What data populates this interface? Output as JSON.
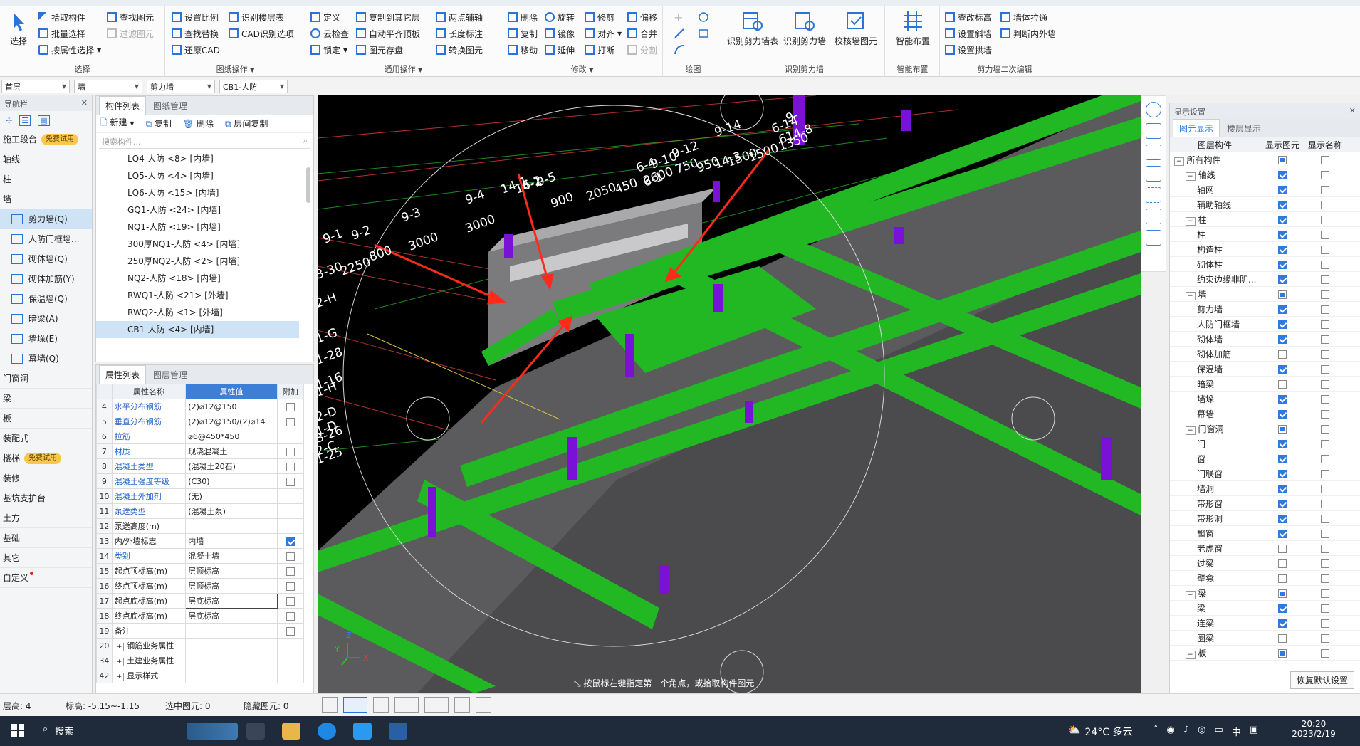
{
  "ribbon": {
    "tabs": [],
    "select": {
      "title": "选择",
      "big": "选择",
      "items": [
        "拾取构件",
        "批量选择",
        "按属性选择",
        "查找图元",
        "过滤图元"
      ]
    },
    "drawing_ops": {
      "title": "图纸操作",
      "items": [
        "设置比例",
        "查找替换",
        "还原CAD",
        "识别楼层表",
        "CAD识别选项"
      ]
    },
    "general_ops": {
      "title": "通用操作",
      "items": [
        "定义",
        "云检查",
        "锁定",
        "复制到其它层",
        "自动平齐顶板",
        "图元存盘",
        "两点辅轴",
        "长度标注",
        "转换图元"
      ]
    },
    "modify": {
      "title": "修改",
      "items": [
        "删除",
        "复制",
        "移动",
        "旋转",
        "镜像",
        "延伸",
        "修剪",
        "对齐",
        "打断",
        "偏移",
        "合并",
        "分割"
      ]
    },
    "draw": {
      "title": "绘图"
    },
    "recognize": {
      "title": "识别剪力墙",
      "items": [
        "识别剪力墙表",
        "识别剪力墙",
        "校核墙图元"
      ]
    },
    "smart": {
      "title": "智能布置",
      "items": [
        "智能布置"
      ]
    },
    "secondary": {
      "title": "剪力墙二次编辑",
      "items": [
        "查改标高",
        "设置斜墙",
        "设置拱墙",
        "墙体拉通",
        "判断内外墙"
      ]
    }
  },
  "floorbar": {
    "floor": "首层",
    "type": "墙",
    "subtype": "剪力墙",
    "component": "CB1-人防"
  },
  "nav": {
    "title": "导航栏",
    "trial_label": "免费试用",
    "categories_top": [
      "施工段台",
      "轴线",
      "柱",
      "墙"
    ],
    "wall_items": [
      "剪力墙(Q)",
      "人防门框墙...",
      "砌体墙(Q)",
      "砌体加筋(Y)",
      "保温墙(Q)",
      "暗梁(A)",
      "墙垛(E)",
      "幕墙(Q)"
    ],
    "categories_bottom": [
      "门窗洞",
      "梁",
      "板",
      "装配式",
      "楼梯",
      "装修",
      "基坑支护台",
      "土方",
      "基础",
      "其它",
      "自定义"
    ]
  },
  "comp_panel": {
    "tabs": [
      "构件列表",
      "图纸管理"
    ],
    "tools": [
      "新建",
      "复制",
      "删除",
      "层间复制"
    ],
    "search_placeholder": "搜索构件...",
    "items": [
      "LQ4-人防 <8> [内墙]",
      "LQ5-人防 <4> [内墙]",
      "LQ6-人防 <15> [内墙]",
      "GQ1-人防 <24> [内墙]",
      "NQ1-人防 <19> [内墙]",
      "300厚NQ1-人防 <4> [内墙]",
      "250厚NQ2-人防 <2> [内墙]",
      "NQ2-人防 <18> [内墙]",
      "RWQ1-人防 <21> [外墙]",
      "RWQ2-人防 <1> [外墙]",
      "CB1-人防 <4> [内墙]"
    ],
    "selected_index": 10
  },
  "prop_panel": {
    "tabs": [
      "属性列表",
      "图层管理"
    ],
    "headers": [
      "属性名称",
      "属性值",
      "附加"
    ],
    "rows": [
      {
        "n": "4",
        "name": "水平分布钢筋",
        "value": "(2)⌀12@150",
        "link": true,
        "add": "off"
      },
      {
        "n": "5",
        "name": "垂直分布钢筋",
        "value": "(2)⌀12@150/(2)⌀14",
        "link": true,
        "add": "off"
      },
      {
        "n": "6",
        "name": "拉筋",
        "value": "⌀6@450*450",
        "link": true,
        "add": ""
      },
      {
        "n": "7",
        "name": "材质",
        "value": "现浇混凝土",
        "link": true,
        "add": "off"
      },
      {
        "n": "8",
        "name": "混凝土类型",
        "value": "(混凝土20石)",
        "link": true,
        "add": "off"
      },
      {
        "n": "9",
        "name": "混凝土强度等级",
        "value": "(C30)",
        "link": true,
        "add": "off"
      },
      {
        "n": "10",
        "name": "混凝土外加剂",
        "value": "(无)",
        "link": true,
        "add": ""
      },
      {
        "n": "11",
        "name": "泵送类型",
        "value": "(混凝土泵)",
        "link": true,
        "add": ""
      },
      {
        "n": "12",
        "name": "泵送高度(m)",
        "value": "",
        "link": false,
        "add": ""
      },
      {
        "n": "13",
        "name": "内/外墙标志",
        "value": "内墙",
        "link": false,
        "add": "on"
      },
      {
        "n": "14",
        "name": "类别",
        "value": "混凝土墙",
        "link": true,
        "add": "off"
      },
      {
        "n": "15",
        "name": "起点顶标高(m)",
        "value": "层顶标高",
        "link": false,
        "add": "off"
      },
      {
        "n": "16",
        "name": "终点顶标高(m)",
        "value": "层顶标高",
        "link": false,
        "add": "off"
      },
      {
        "n": "17",
        "name": "起点底标高(m)",
        "value": "层底标高",
        "link": false,
        "add": "off"
      },
      {
        "n": "18",
        "name": "终点底标高(m)",
        "value": "层底标高",
        "link": false,
        "add": "off"
      },
      {
        "n": "19",
        "name": "备注",
        "value": "",
        "link": false,
        "add": "off"
      },
      {
        "n": "20",
        "name": "钢筋业务属性",
        "value": "",
        "link": false,
        "add": "",
        "expand": true
      },
      {
        "n": "34",
        "name": "土建业务属性",
        "value": "",
        "link": false,
        "add": "",
        "expand": true
      },
      {
        "n": "42",
        "name": "显示样式",
        "value": "",
        "link": false,
        "add": "",
        "expand": true
      }
    ]
  },
  "viewport": {
    "labels": [
      "9-14",
      "6-14",
      "6-1",
      "9-10",
      "9-12",
      "6-4",
      "614-8",
      "9-",
      "14-3",
      "1350",
      "750",
      "950",
      "1500",
      "1500",
      "2600",
      "2050",
      "450",
      "900",
      "3000",
      "3000",
      "800",
      "2250",
      "9-3",
      "9-4",
      "14-1",
      "14-1",
      "6-2",
      "9-5",
      "9-1",
      "9-2",
      "3-30",
      "2-H",
      "1-G",
      "1-28",
      "2-D",
      "1-D",
      "3-26",
      "2-C",
      "1-25",
      "1-16",
      "1-H"
    ],
    "status_hint": "按鼠标左键指定第一个角点，或拾取构件图元"
  },
  "display_panel": {
    "title": "显示设置",
    "tabs": [
      "图元显示",
      "楼层显示"
    ],
    "headers": [
      "图层构件",
      "显示图元",
      "显示名称"
    ],
    "rows": [
      {
        "name": "所有构件",
        "lvl": 0,
        "exp": true,
        "a": "part",
        "b": "off"
      },
      {
        "name": "轴线",
        "lvl": 1,
        "exp": true,
        "a": "on",
        "b": "off"
      },
      {
        "name": "轴网",
        "lvl": 2,
        "a": "on",
        "b": "off"
      },
      {
        "name": "辅助轴线",
        "lvl": 2,
        "a": "on",
        "b": "off"
      },
      {
        "name": "柱",
        "lvl": 1,
        "exp": true,
        "a": "on",
        "b": "off"
      },
      {
        "name": "柱",
        "lvl": 2,
        "a": "on",
        "b": "off"
      },
      {
        "name": "构造柱",
        "lvl": 2,
        "a": "on",
        "b": "off"
      },
      {
        "name": "砌体柱",
        "lvl": 2,
        "a": "on",
        "b": "off"
      },
      {
        "name": "约束边缘非阴...",
        "lvl": 2,
        "a": "on",
        "b": "off"
      },
      {
        "name": "墙",
        "lvl": 1,
        "exp": true,
        "a": "part",
        "b": "off"
      },
      {
        "name": "剪力墙",
        "lvl": 2,
        "a": "on",
        "b": "off"
      },
      {
        "name": "人防门框墙",
        "lvl": 2,
        "a": "on",
        "b": "off"
      },
      {
        "name": "砌体墙",
        "lvl": 2,
        "a": "on",
        "b": "off"
      },
      {
        "name": "砌体加筋",
        "lvl": 2,
        "a": "off",
        "b": "off"
      },
      {
        "name": "保温墙",
        "lvl": 2,
        "a": "on",
        "b": "off"
      },
      {
        "name": "暗梁",
        "lvl": 2,
        "a": "off",
        "b": "off"
      },
      {
        "name": "墙垛",
        "lvl": 2,
        "a": "on",
        "b": "off"
      },
      {
        "name": "幕墙",
        "lvl": 2,
        "a": "on",
        "b": "off"
      },
      {
        "name": "门窗洞",
        "lvl": 1,
        "exp": true,
        "a": "part",
        "b": "off"
      },
      {
        "name": "门",
        "lvl": 2,
        "a": "on",
        "b": "off"
      },
      {
        "name": "窗",
        "lvl": 2,
        "a": "on",
        "b": "off"
      },
      {
        "name": "门联窗",
        "lvl": 2,
        "a": "on",
        "b": "off"
      },
      {
        "name": "墙洞",
        "lvl": 2,
        "a": "on",
        "b": "off"
      },
      {
        "name": "带形窗",
        "lvl": 2,
        "a": "on",
        "b": "off"
      },
      {
        "name": "带形洞",
        "lvl": 2,
        "a": "on",
        "b": "off"
      },
      {
        "name": "飘窗",
        "lvl": 2,
        "a": "on",
        "b": "off"
      },
      {
        "name": "老虎窗",
        "lvl": 2,
        "a": "off",
        "b": "off"
      },
      {
        "name": "过梁",
        "lvl": 2,
        "a": "off",
        "b": "off"
      },
      {
        "name": "壁龛",
        "lvl": 2,
        "a": "off",
        "b": "off"
      },
      {
        "name": "梁",
        "lvl": 1,
        "exp": true,
        "a": "part",
        "b": "off"
      },
      {
        "name": "梁",
        "lvl": 2,
        "a": "on",
        "b": "off"
      },
      {
        "name": "连梁",
        "lvl": 2,
        "a": "on",
        "b": "off"
      },
      {
        "name": "圈梁",
        "lvl": 2,
        "a": "off",
        "b": "off"
      },
      {
        "name": "板",
        "lvl": 1,
        "exp": true,
        "a": "part",
        "b": "off"
      }
    ],
    "restore_button": "恢复默认设置"
  },
  "status": {
    "floor_h": "层高: 4",
    "elev": "标高: -5.15~-1.15",
    "sel": "选中图元: 0",
    "hidden": "隐藏图元: 0"
  },
  "taskbar": {
    "search": "搜索",
    "weather": "24°C 多云",
    "ime": "中",
    "time": "20:20",
    "date": "2023/2/19"
  }
}
